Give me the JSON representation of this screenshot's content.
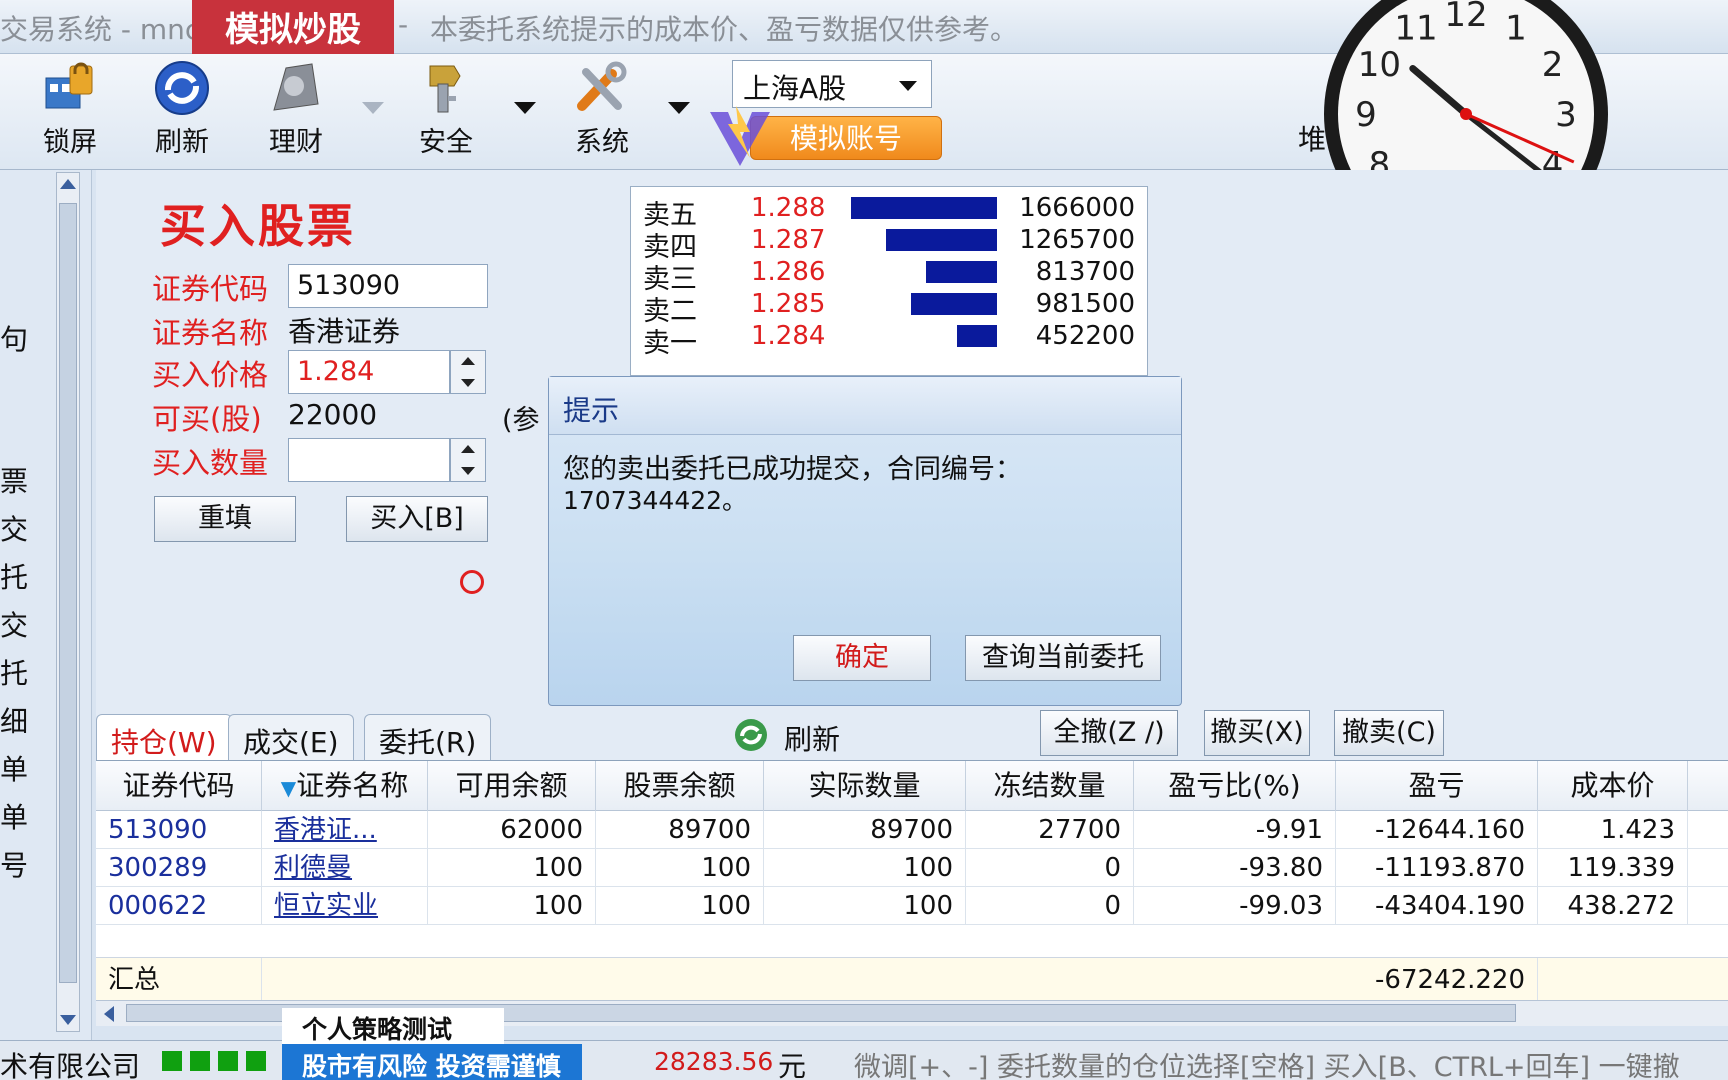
{
  "titlebar": {
    "title": "交易系统 - mnc",
    "separator": "-",
    "notice": "本委托系统提示的成本价、盈亏数据仅供参考。",
    "sim_badge": "模拟炒股"
  },
  "toolbar": {
    "buttons": [
      {
        "label": "锁屏",
        "icon": "lock-screen-icon"
      },
      {
        "label": "刷新",
        "icon": "refresh-icon"
      },
      {
        "label": "理财",
        "icon": "finance-icon"
      },
      {
        "label": "安全",
        "icon": "security-icon"
      },
      {
        "label": "系统",
        "icon": "system-tools-icon"
      }
    ],
    "market": "上海A股",
    "sim_account": "模拟账号",
    "trail_text": "堆"
  },
  "clock": {
    "hour": 10,
    "minute": 21,
    "second": 19
  },
  "left_strip": [
    "句",
    "票",
    "交",
    "托",
    "交",
    "托",
    "细",
    "单",
    "单",
    "号"
  ],
  "form": {
    "title": "买入股票",
    "code_label": "证券代码",
    "code_value": "513090",
    "name_label": "证券名称",
    "name_value": "香港证券",
    "price_label": "买入价格",
    "price_value": "1.284",
    "avail_label": "可买(股)",
    "avail_value": "22000",
    "qty_label": "买入数量",
    "qty_value": "",
    "reset_button": "重填",
    "buy_button": "买入[B]",
    "ref_note": "(参"
  },
  "orderbook": {
    "rows": [
      {
        "label": "卖五",
        "price": "1.288",
        "volume": "1666000",
        "bar": 1666000
      },
      {
        "label": "卖四",
        "price": "1.287",
        "volume": "1265700",
        "bar": 1265700
      },
      {
        "label": "卖三",
        "price": "1.286",
        "volume": "813700",
        "bar": 813700
      },
      {
        "label": "卖二",
        "price": "1.285",
        "volume": "981500",
        "bar": 981500
      },
      {
        "label": "卖一",
        "price": "1.284",
        "volume": "452200",
        "bar": 452200
      }
    ],
    "max_volume": 1666000
  },
  "dialog": {
    "title": "提示",
    "message": "您的卖出委托已成功提交，合同编号：",
    "contract": "1707344422。",
    "ok": "确定",
    "query": "查询当前委托"
  },
  "tabs": [
    {
      "label": "持仓(W)",
      "active": true
    },
    {
      "label": "成交(E)",
      "active": false
    },
    {
      "label": "委托(R)",
      "active": false
    }
  ],
  "list_toolbar": {
    "refresh": "刷新",
    "cancel_all": "全撤(Z /)",
    "cancel_buy": "撤买(X)",
    "cancel_sell": "撤卖(C)"
  },
  "table": {
    "headers": [
      "证券代码",
      "证券名称",
      "可用余额",
      "股票余额",
      "实际数量",
      "冻结数量",
      "盈亏比(%)",
      "盈亏",
      "成本价"
    ],
    "rows": [
      [
        "513090",
        "香港证...",
        "62000",
        "89700",
        "89700",
        "27700",
        "-9.91",
        "-12644.160",
        "1.423"
      ],
      [
        "300289",
        "利德曼",
        "100",
        "100",
        "100",
        "0",
        "-93.80",
        "-11193.870",
        "119.339"
      ],
      [
        "000622",
        "恒立实业",
        "100",
        "100",
        "100",
        "0",
        "-99.03",
        "-43404.190",
        "438.272"
      ]
    ],
    "total_label": "汇总",
    "total_pnl": "-67242.220"
  },
  "statusbar": {
    "company": "术有限公司",
    "amount": "28283.56",
    "unit": "元",
    "hint": "微调[+、-] 委托数量的仓位选择[空格] 买入[B、CTRL+回车] 一键撤"
  },
  "overlay": {
    "strategy": "个人策略测试",
    "risk": "股市有风险 投资需谨慎"
  },
  "colors": {
    "accent_red": "#e02020",
    "sell_bar": "#0a1a9c",
    "link_blue": "#1a2f9c"
  }
}
